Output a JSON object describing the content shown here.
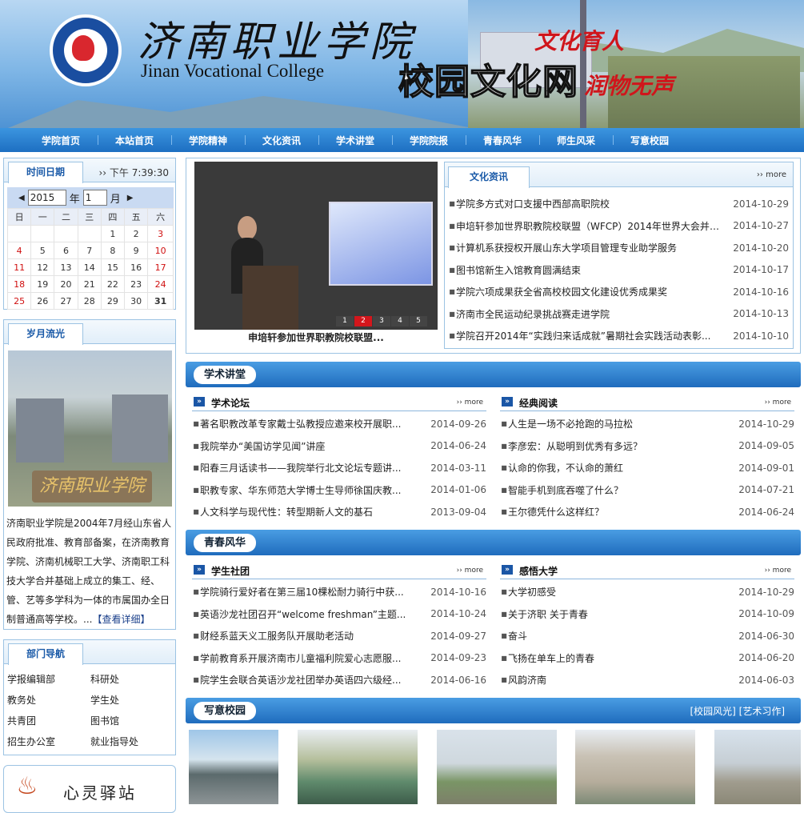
{
  "header": {
    "college_cn": "济南职业学院",
    "college_en": "Jinan Vocational College",
    "site_title": "校园文化网",
    "slogan1": "文化育人",
    "slogan2": "润物无声"
  },
  "nav": [
    "学院首页",
    "本站首页",
    "学院精神",
    "文化资讯",
    "学术讲堂",
    "学院院报",
    "青春风华",
    "师生风采",
    "写意校园"
  ],
  "datebox": {
    "tab": "时间日期",
    "clock": "下午 7:39:30",
    "year": "2015",
    "year_label": "年",
    "month": "1",
    "month_label": "月",
    "weekdays": [
      "日",
      "一",
      "二",
      "三",
      "四",
      "五",
      "六"
    ],
    "weeks": [
      [
        "",
        "",
        "",
        "",
        "1",
        "2",
        "3"
      ],
      [
        "4",
        "5",
        "6",
        "7",
        "8",
        "9",
        "10"
      ],
      [
        "11",
        "12",
        "13",
        "14",
        "15",
        "16",
        "17"
      ],
      [
        "18",
        "19",
        "20",
        "21",
        "22",
        "23",
        "24"
      ],
      [
        "25",
        "26",
        "27",
        "28",
        "29",
        "30",
        "31"
      ]
    ]
  },
  "years": {
    "tab": "岁月流光",
    "stone_text": "济南职业学院",
    "intro": "济南职业学院是2004年7月经山东省人民政府批准、教育部备案，在济南教育学院、济南机械职工大学、济南职工科技大学合并基础上成立的集工、经、管、艺等多学科为一体的市属国办全日制普通高等学校。...",
    "more": "【查看详细】"
  },
  "depts": {
    "tab": "部门导航",
    "items": [
      "学报编辑部",
      "科研处",
      "教务处",
      "学生处",
      "共青团",
      "图书馆",
      "招生办公室",
      "就业指导处"
    ]
  },
  "heart": {
    "label": "心灵驿站"
  },
  "feature": {
    "caption": "申培轩参加世界职教院校联盟...",
    "pages": [
      "1",
      "2",
      "3",
      "4",
      "5"
    ],
    "active_page": "2"
  },
  "culture_news": {
    "tab": "文化资讯",
    "more": "more",
    "items": [
      {
        "t": "学院多方式对口支援中西部高职院校",
        "d": "2014-10-29"
      },
      {
        "t": "申培轩参加世界职教院校联盟（WFCP）2014年世界大会并在...",
        "d": "2014-10-27"
      },
      {
        "t": "计算机系获授权开展山东大学项目管理专业助学服务",
        "d": "2014-10-20"
      },
      {
        "t": "图书馆新生入馆教育圆满结束",
        "d": "2014-10-17"
      },
      {
        "t": "学院六项成果获全省高校校园文化建设优秀成果奖",
        "d": "2014-10-16"
      },
      {
        "t": "济南市全民运动纪录挑战赛走进学院",
        "d": "2014-10-13"
      },
      {
        "t": "学院召开2014年“实践归来话成就”暑期社会实践活动表彰...",
        "d": "2014-10-10"
      }
    ]
  },
  "lecture": {
    "title": "学术讲堂",
    "forum": {
      "name": "学术论坛",
      "more": "more",
      "items": [
        {
          "t": "著名职教改革专家戴士弘教授应邀来校开展职...",
          "d": "2014-09-26"
        },
        {
          "t": "我院举办“美国访学见闻”讲座",
          "d": "2014-06-24"
        },
        {
          "t": "阳春三月话读书——我院举行北文论坛专题讲...",
          "d": "2014-03-11"
        },
        {
          "t": "职教专家、华东师范大学博士生导师徐国庆教...",
          "d": "2014-01-06"
        },
        {
          "t": "人文科学与现代性：转型期新人文的基石",
          "d": "2013-09-04"
        }
      ]
    },
    "classic": {
      "name": "经典阅读",
      "more": "more",
      "items": [
        {
          "t": "人生是一场不必抢跑的马拉松",
          "d": "2014-10-29"
        },
        {
          "t": "李彦宏：从聪明到优秀有多远？",
          "d": "2014-09-05"
        },
        {
          "t": "认命的你我，不认命的萧红",
          "d": "2014-09-01"
        },
        {
          "t": "智能手机到底吞噬了什么？",
          "d": "2014-07-21"
        },
        {
          "t": "王尔德凭什么这样红？",
          "d": "2014-06-24"
        }
      ]
    }
  },
  "youth": {
    "title": "青春风华",
    "clubs": {
      "name": "学生社团",
      "more": "more",
      "items": [
        {
          "t": "学院骑行爱好者在第三届10棵松耐力骑行中获...",
          "d": "2014-10-16"
        },
        {
          "t": "英语沙龙社团召开“welcome freshman”主题...",
          "d": "2014-10-24"
        },
        {
          "t": "财经系蓝天义工服务队开展助老活动",
          "d": "2014-09-27"
        },
        {
          "t": "学前教育系开展济南市儿童福利院爱心志愿服...",
          "d": "2014-09-23"
        },
        {
          "t": "院学生会联合英语沙龙社团举办英语四六级经...",
          "d": "2014-06-16"
        }
      ]
    },
    "insight": {
      "name": "感悟大学",
      "more": "more",
      "items": [
        {
          "t": "大学初感受",
          "d": "2014-10-29"
        },
        {
          "t": "关于济职 关于青春",
          "d": "2014-10-09"
        },
        {
          "t": "奋斗",
          "d": "2014-06-30"
        },
        {
          "t": "飞扬在单车上的青春",
          "d": "2014-06-20"
        },
        {
          "t": "风韵济南",
          "d": "2014-06-03"
        }
      ]
    }
  },
  "campus": {
    "title": "写意校园",
    "links": "[校园风光]  [艺术习作]"
  }
}
